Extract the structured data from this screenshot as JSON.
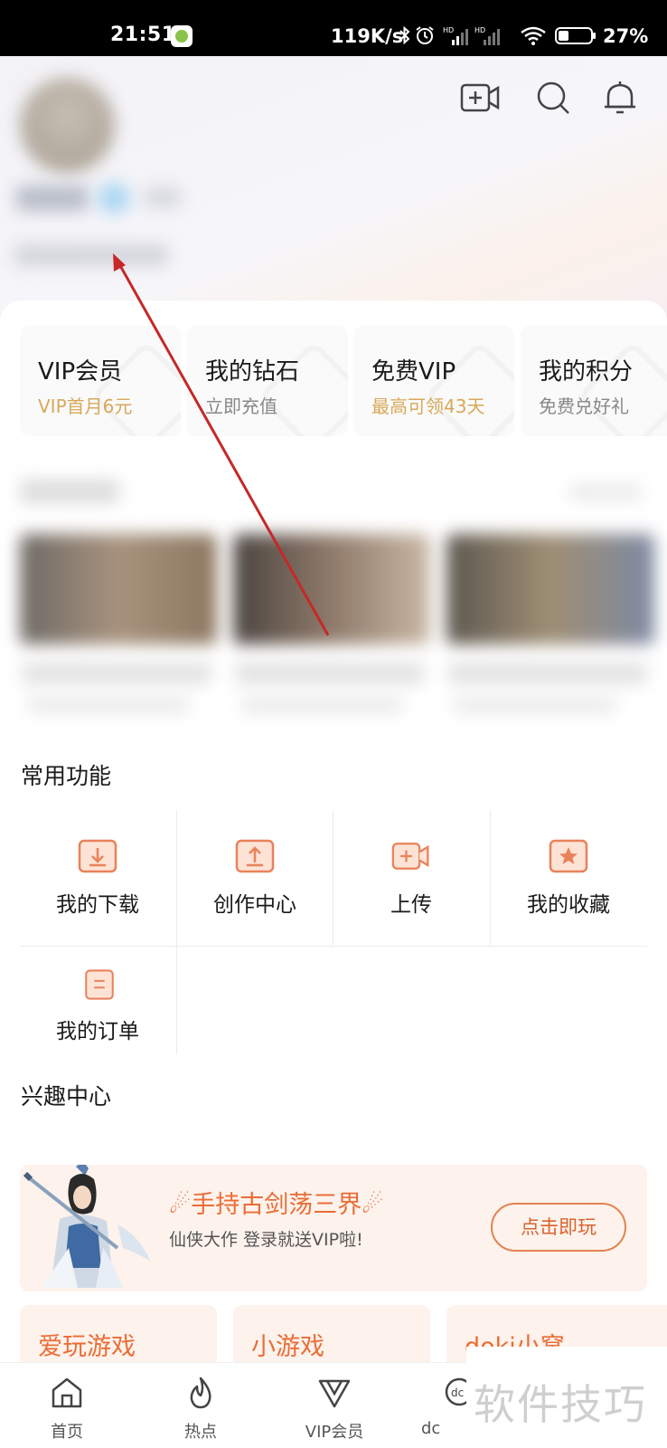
{
  "status_bar": {
    "time": "21:51",
    "net_speed": "119K/s",
    "battery": "27%",
    "icons": [
      "app-notification-icon",
      "bluetooth-icon",
      "alarm-icon",
      "hd-signal-icon",
      "hd-signal-icon",
      "wifi-icon",
      "battery-icon"
    ]
  },
  "header": {
    "actions": [
      "video-camera-icon",
      "search-icon",
      "bell-icon"
    ]
  },
  "vip_cards": [
    {
      "title": "VIP会员",
      "subtitle": "VIP首月6元",
      "sub_color": "#d8a85a"
    },
    {
      "title": "我的钻石",
      "subtitle": "立即充值",
      "sub_color": "#888888"
    },
    {
      "title": "免费VIP",
      "subtitle": "最高可领43天",
      "sub_color": "#d8a85a"
    },
    {
      "title": "我的积分",
      "subtitle": "免费兑好礼",
      "sub_color": "#888888"
    }
  ],
  "common_functions": {
    "title": "常用功能",
    "items": [
      {
        "label": "我的下载",
        "icon": "download-icon"
      },
      {
        "label": "创作中心",
        "icon": "upload-icon"
      },
      {
        "label": "上传",
        "icon": "video-add-icon"
      },
      {
        "label": "我的收藏",
        "icon": "star-favorite-icon"
      },
      {
        "label": "我的订单",
        "icon": "order-icon"
      }
    ]
  },
  "interest_center": {
    "title": "兴趣中心",
    "banner": {
      "title": "手持古剑荡三界",
      "subtitle": "仙侠大作 登录就送VIP啦!",
      "button": "点击即玩"
    },
    "cards": [
      "爱玩游戏",
      "小游戏",
      "doki小窝"
    ]
  },
  "bottom_nav": [
    {
      "label": "首页",
      "icon": "home-icon"
    },
    {
      "label": "热点",
      "icon": "flame-icon"
    },
    {
      "label": "VIP会员",
      "icon": "vip-icon"
    },
    {
      "label": "dc",
      "icon": "doki-icon"
    }
  ],
  "watermark": "软件技巧",
  "colors": {
    "accent_orange": "#ea6d36",
    "gold": "#d8a85a",
    "icon_orange": "#e9825a",
    "annotation_red": "#c62828"
  }
}
